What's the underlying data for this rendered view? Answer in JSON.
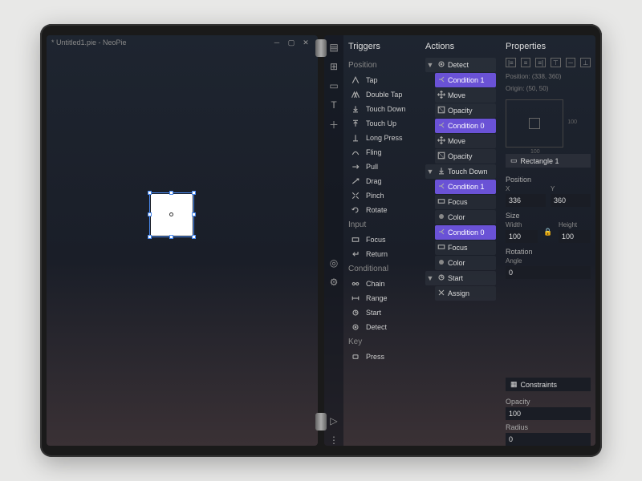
{
  "window": {
    "title": "* Untitled1.pie - NeoPie"
  },
  "canvas": {
    "shape": "Rectangle"
  },
  "toolbar": {
    "items": [
      "layers",
      "grid",
      "artboard",
      "text",
      "add"
    ],
    "lower": [
      "target",
      "settings"
    ],
    "footer": [
      "play",
      "more"
    ]
  },
  "triggers": {
    "heading": "Triggers",
    "groups": [
      {
        "name": "Position",
        "items": [
          {
            "icon": "tap",
            "label": "Tap"
          },
          {
            "icon": "dtap",
            "label": "Double Tap"
          },
          {
            "icon": "tdown",
            "label": "Touch Down"
          },
          {
            "icon": "tup",
            "label": "Touch Up"
          },
          {
            "icon": "lpress",
            "label": "Long Press"
          },
          {
            "icon": "fling",
            "label": "Fling"
          },
          {
            "icon": "pull",
            "label": "Pull"
          },
          {
            "icon": "drag",
            "label": "Drag"
          },
          {
            "icon": "pinch",
            "label": "Pinch"
          },
          {
            "icon": "rotate",
            "label": "Rotate"
          }
        ]
      },
      {
        "name": "Input",
        "items": [
          {
            "icon": "focus",
            "label": "Focus"
          },
          {
            "icon": "return",
            "label": "Return"
          }
        ]
      },
      {
        "name": "Conditional",
        "items": [
          {
            "icon": "chain",
            "label": "Chain"
          },
          {
            "icon": "range",
            "label": "Range"
          },
          {
            "icon": "start",
            "label": "Start"
          },
          {
            "icon": "detect",
            "label": "Detect"
          }
        ]
      },
      {
        "name": "Key",
        "items": [
          {
            "icon": "press",
            "label": "Press"
          }
        ]
      }
    ]
  },
  "actions": {
    "heading": "Actions",
    "blocks": [
      {
        "type": "grp",
        "arrow": "▼",
        "icon": "detect",
        "label": "Detect"
      },
      {
        "type": "cond",
        "icon": "branch",
        "label": "Condition 1"
      },
      {
        "type": "sub",
        "icon": "move",
        "label": "Move"
      },
      {
        "type": "sub",
        "icon": "opacity",
        "label": "Opacity"
      },
      {
        "type": "cond",
        "icon": "branch",
        "label": "Condition 0"
      },
      {
        "type": "sub",
        "icon": "move",
        "label": "Move"
      },
      {
        "type": "sub",
        "icon": "opacity",
        "label": "Opacity"
      },
      {
        "type": "grp",
        "arrow": "▼",
        "icon": "tdown",
        "label": "Touch Down"
      },
      {
        "type": "cond",
        "icon": "branch",
        "label": "Condition 1"
      },
      {
        "type": "sub",
        "icon": "focus",
        "label": "Focus"
      },
      {
        "type": "sub",
        "icon": "color",
        "label": "Color"
      },
      {
        "type": "cond",
        "icon": "branch",
        "label": "Condition 0"
      },
      {
        "type": "sub",
        "icon": "focus",
        "label": "Focus"
      },
      {
        "type": "sub",
        "icon": "color",
        "label": "Color"
      },
      {
        "type": "grp",
        "arrow": "▼",
        "icon": "start",
        "label": "Start"
      },
      {
        "type": "sub",
        "icon": "assign",
        "label": "Assign",
        "noindent": true
      }
    ]
  },
  "props": {
    "heading": "Properties",
    "position_meta": "Position: (338, 360)",
    "origin_meta": "Origin: (50, 50)",
    "preview": {
      "x": "100",
      "y": "100"
    },
    "object": "Rectangle 1",
    "sections": {
      "position": {
        "label": "Position",
        "x_label": "X",
        "y_label": "Y",
        "x": "336",
        "y": "360"
      },
      "size": {
        "label": "Size",
        "w_label": "Width",
        "h_label": "Height",
        "w": "100",
        "h": "100"
      },
      "rotation": {
        "label": "Rotation",
        "a_label": "Angle",
        "angle": "0"
      },
      "constraints": {
        "label": "Constraints"
      },
      "opacity": {
        "label": "Opacity",
        "value": "100"
      },
      "radius": {
        "label": "Radius",
        "value": "0"
      }
    }
  }
}
